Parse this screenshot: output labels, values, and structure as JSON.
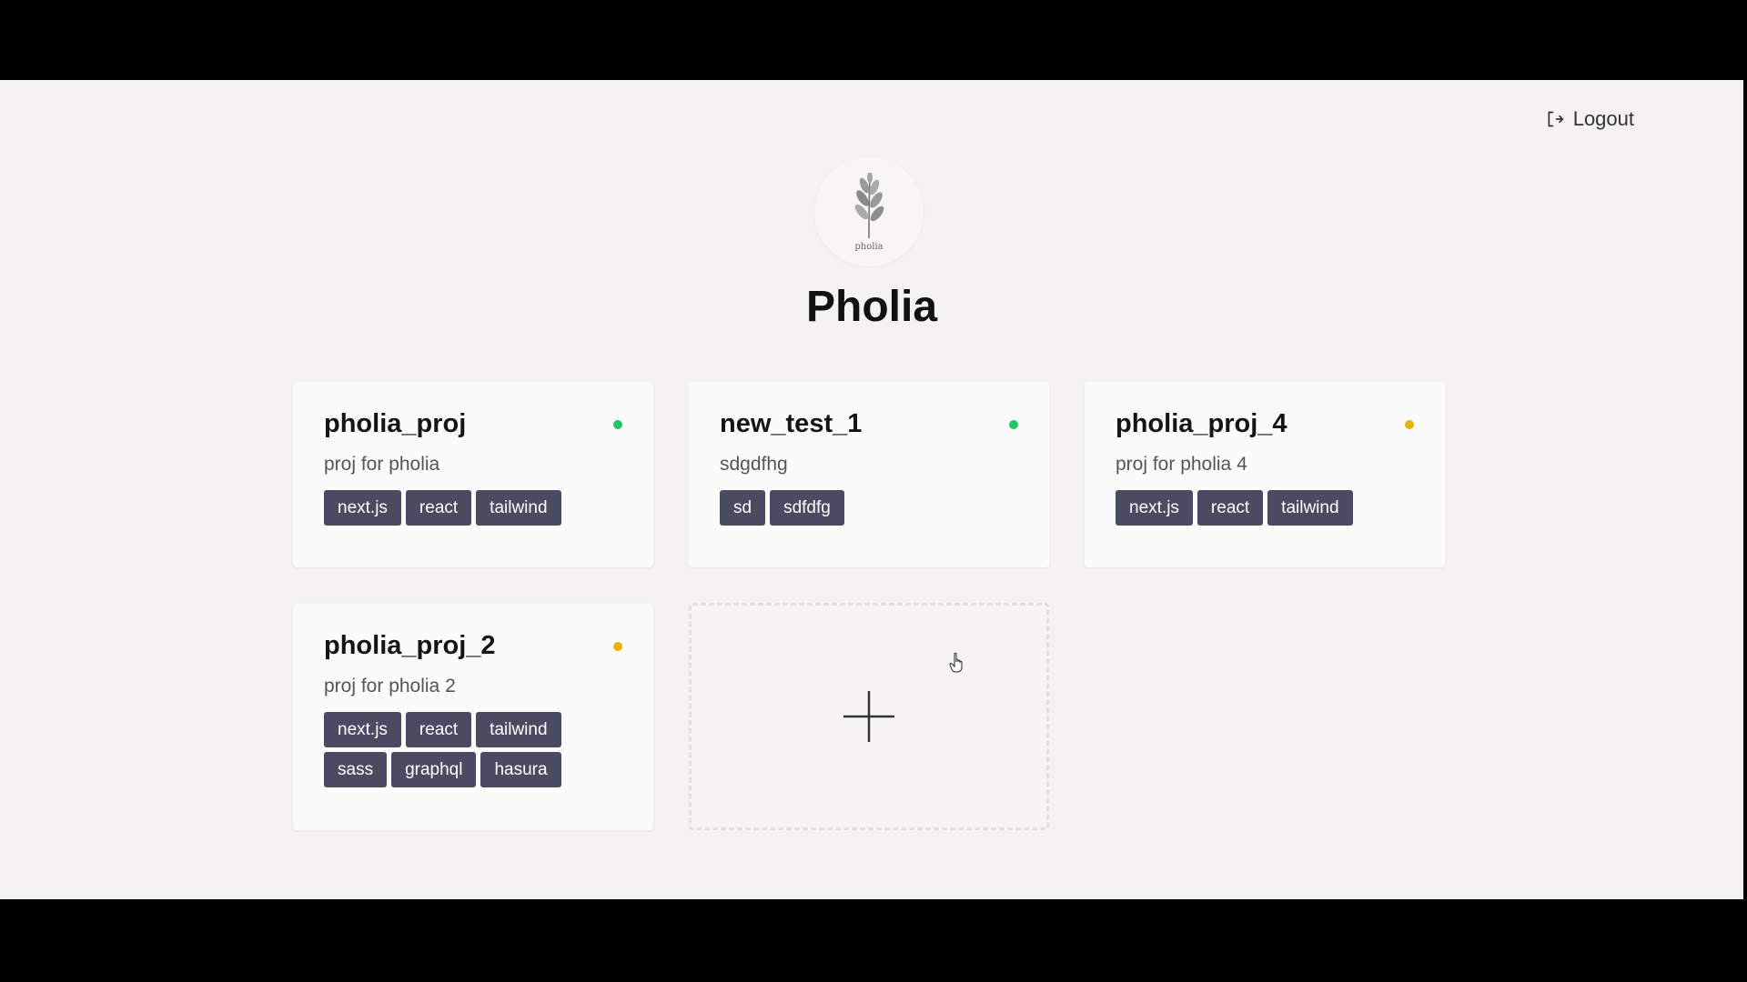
{
  "app": {
    "title": "Pholia",
    "logo_text": "pholia"
  },
  "header": {
    "logout_label": "Logout"
  },
  "colors": {
    "page_background": "#f5f3f2",
    "tag_background": "#4a4b63",
    "status_green": "#22c55e",
    "status_yellow": "#eab308"
  },
  "projects": [
    {
      "name": "pholia_proj",
      "description": "proj for pholia",
      "status": "green",
      "tags": [
        "next.js",
        "react",
        "tailwind"
      ]
    },
    {
      "name": "new_test_1",
      "description": "sdgdfhg",
      "status": "green",
      "tags": [
        "sd",
        "sdfdfg"
      ]
    },
    {
      "name": "pholia_proj_4",
      "description": "proj for pholia 4",
      "status": "yellow",
      "tags": [
        "next.js",
        "react",
        "tailwind"
      ]
    },
    {
      "name": "pholia_proj_2",
      "description": "proj for pholia 2",
      "status": "yellow",
      "tags": [
        "next.js",
        "react",
        "tailwind",
        "sass",
        "graphql",
        "hasura"
      ]
    }
  ],
  "add_project": {
    "icon": "plus-icon"
  }
}
